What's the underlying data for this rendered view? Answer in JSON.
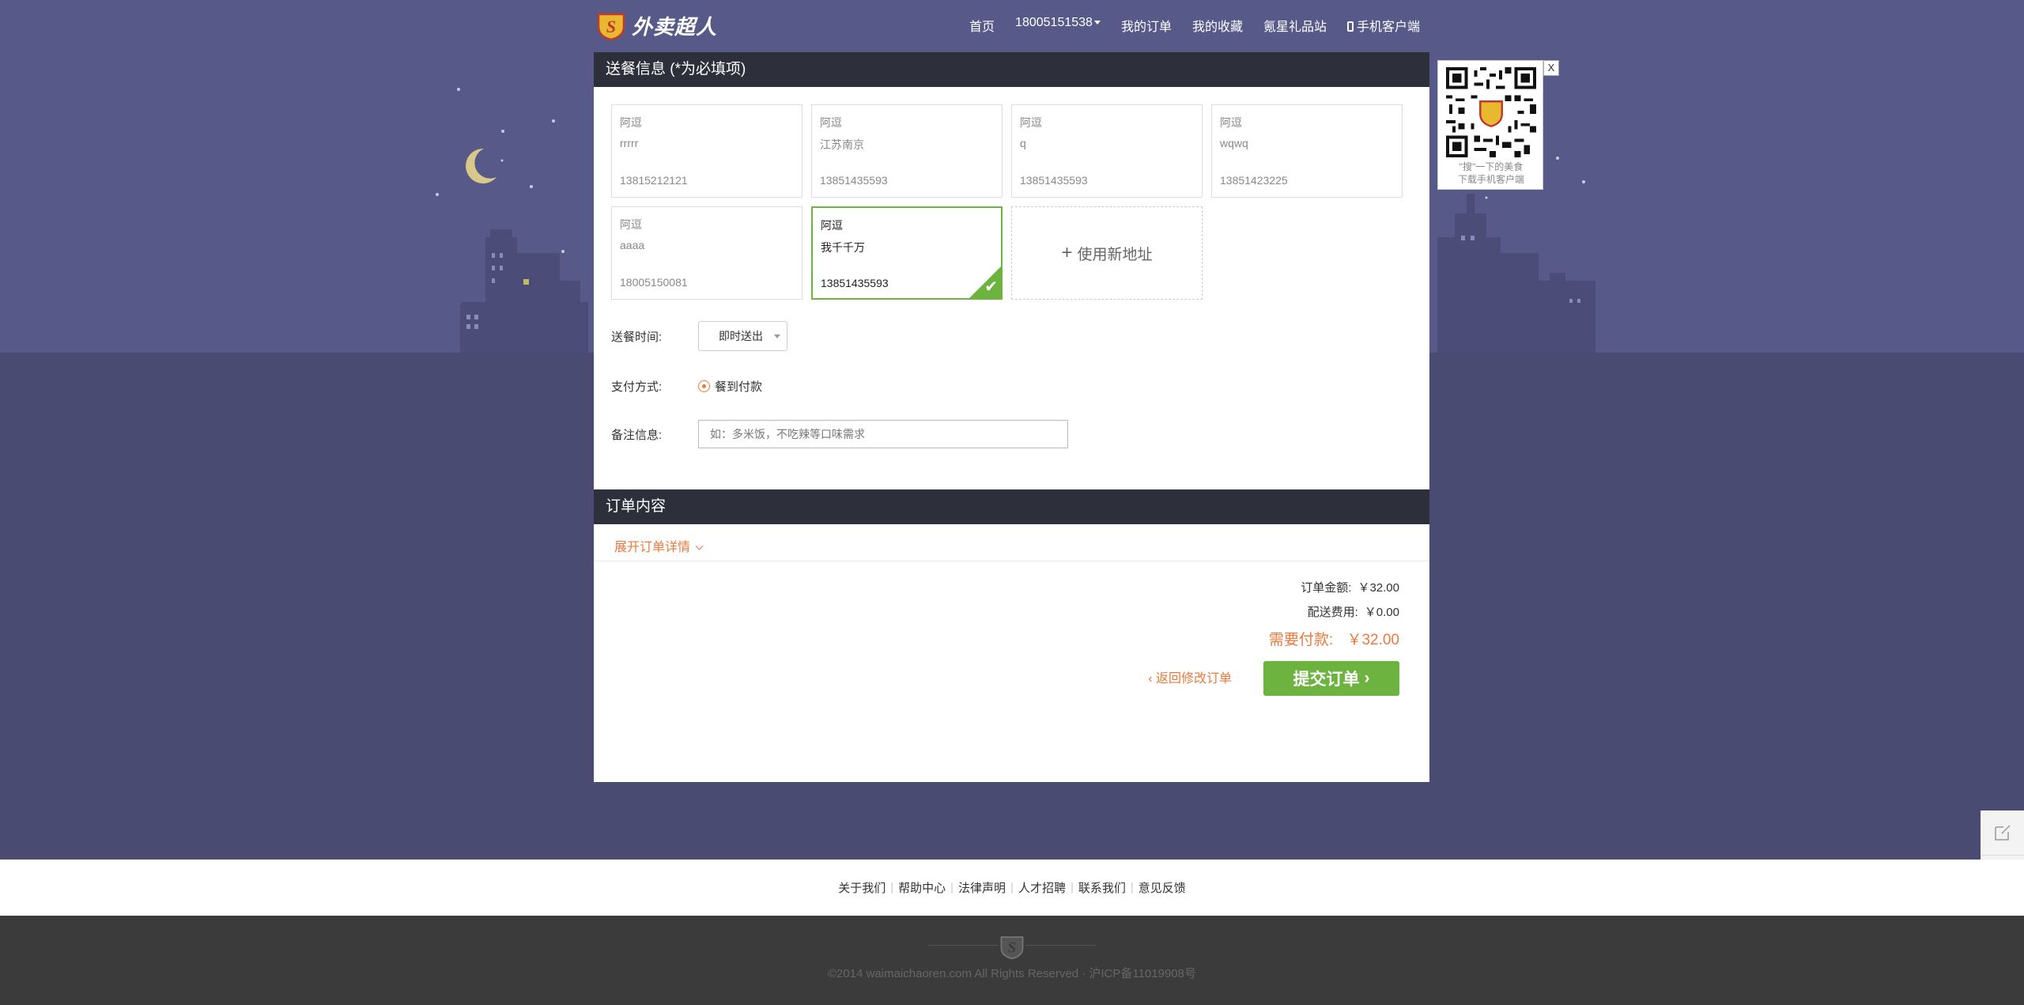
{
  "brand": {
    "name": "外卖超人"
  },
  "nav": {
    "home": "首页",
    "account": "18005151538",
    "orders": "我的订单",
    "favorites": "我的收藏",
    "gift": "氪星礼品站",
    "mobile": "手机客户端"
  },
  "delivery": {
    "title": "送餐信息 (*为必填项)",
    "addresses": [
      {
        "name": "阿逗",
        "address": "rrrrr",
        "phone": "13815212121",
        "selected": false
      },
      {
        "name": "阿逗",
        "address": "江苏南京",
        "phone": "13851435593",
        "selected": false
      },
      {
        "name": "阿逗",
        "address": "q",
        "phone": "13851435593",
        "selected": false
      },
      {
        "name": "阿逗",
        "address": "wqwq",
        "phone": "13851423225",
        "selected": false
      },
      {
        "name": "阿逗",
        "address": "aaaa",
        "phone": "18005150081",
        "selected": false
      },
      {
        "name": "阿逗",
        "address": "我千千万",
        "phone": "13851435593",
        "selected": true
      }
    ],
    "new_address_label": "使用新地址",
    "time_label": "送餐时间:",
    "time_value": "即时送出",
    "payment_label": "支付方式:",
    "payment_value": "餐到付款",
    "note_label": "备注信息:",
    "note_placeholder": "如：多米饭，不吃辣等口味需求"
  },
  "order": {
    "title": "订单内容",
    "expand_label": "展开订单详情",
    "total_label": "订单金额:",
    "total_value": "￥32.00",
    "delivery_fee_label": "配送费用:",
    "delivery_fee_value": "￥0.00",
    "due_label": "需要付款:",
    "due_value": "￥32.00",
    "back_label": "返回修改订单",
    "submit_label": "提交订单"
  },
  "qr": {
    "close": "X",
    "line1": "\"搜\"一下的美食",
    "line2": "下载手机客户端"
  },
  "footer": {
    "links": [
      "关于我们",
      "帮助中心",
      "法律声明",
      "人才招聘",
      "联系我们",
      "意见反馈"
    ],
    "copyright": "©2014 waimaichaoren.com All Rights Reserved · 沪ICP备11019908号"
  },
  "colors": {
    "accent": "#e87a3c",
    "success": "#6db33f",
    "header_bar": "#2d2f3b",
    "sky": "#575a89"
  }
}
